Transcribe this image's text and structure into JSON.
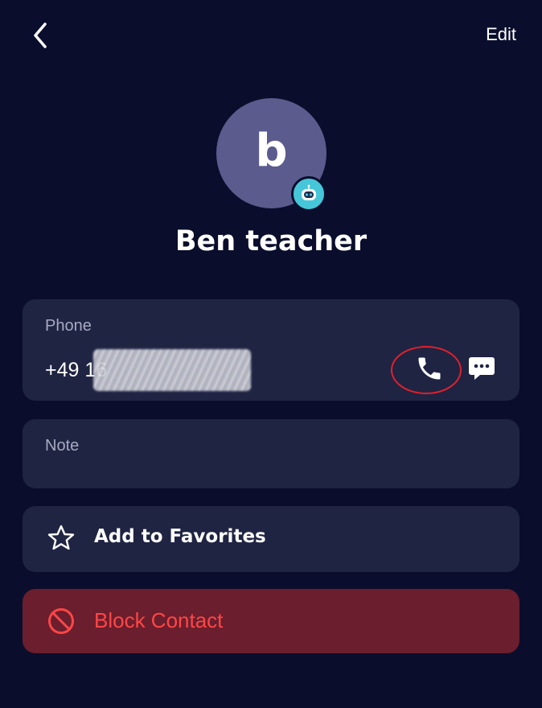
{
  "header": {
    "back_icon": "chevron-left-icon",
    "edit_label": "Edit"
  },
  "contact": {
    "avatar_letter": "b",
    "avatar_color": "#5b5b8e",
    "badge_icon": "robot-icon",
    "badge_color": "#46c7d9",
    "name": "Ben teacher"
  },
  "phone": {
    "label": "Phone",
    "number_visible": "+49 16",
    "call_icon": "phone-icon",
    "message_icon": "message-bubble-icon",
    "highlight_color": "#e0202a"
  },
  "note": {
    "label": "Note"
  },
  "favorites": {
    "icon": "star-outline-icon",
    "label": "Add to Favorites"
  },
  "block": {
    "icon": "block-icon",
    "label": "Block Contact",
    "color": "#ff4646"
  },
  "colors": {
    "background": "#0a0e2c",
    "card": "#1f2443",
    "block_card": "#6b1e2d"
  }
}
